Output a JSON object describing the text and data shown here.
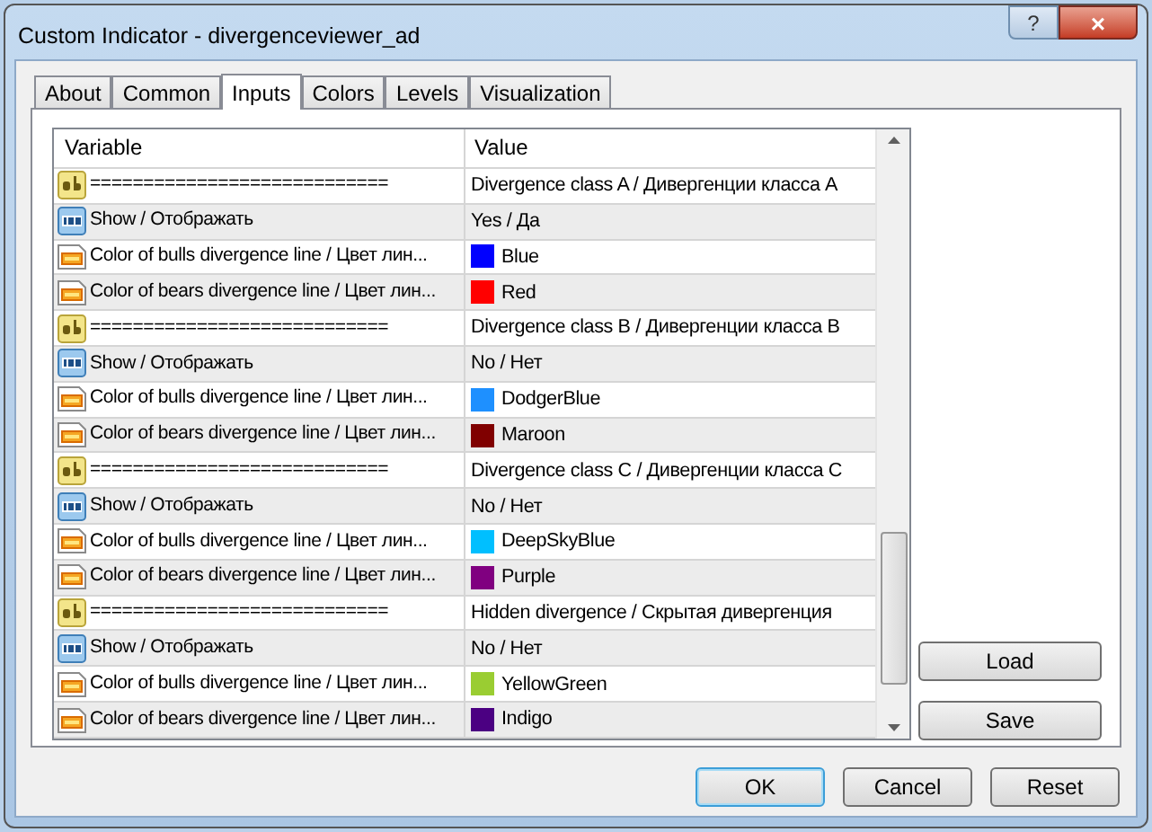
{
  "window": {
    "title": "Custom Indicator - divergenceviewer_ad"
  },
  "tabs": [
    {
      "label": "About",
      "selected": false
    },
    {
      "label": "Common",
      "selected": false
    },
    {
      "label": "Inputs",
      "selected": true
    },
    {
      "label": "Colors",
      "selected": false
    },
    {
      "label": "Levels",
      "selected": false
    },
    {
      "label": "Visualization",
      "selected": false
    }
  ],
  "table": {
    "columns": [
      "Variable",
      "Value"
    ],
    "rows": [
      {
        "kind": "string",
        "variable": "============================",
        "value": "Divergence class A / Дивергенции класса A"
      },
      {
        "kind": "number",
        "variable": "Show / Отображать",
        "value": "Yes / Да"
      },
      {
        "kind": "color",
        "variable": "Color of bulls divergence line / Цвет лин...",
        "value": "Blue",
        "color": "#0000ff"
      },
      {
        "kind": "color",
        "variable": "Color of bears divergence line / Цвет лин...",
        "value": "Red",
        "color": "#ff0000"
      },
      {
        "kind": "string",
        "variable": "============================",
        "value": "Divergence class B / Дивергенции класса B"
      },
      {
        "kind": "number",
        "variable": "Show / Отображать",
        "value": "No / Нет"
      },
      {
        "kind": "color",
        "variable": "Color of bulls divergence line / Цвет лин...",
        "value": "DodgerBlue",
        "color": "#1e90ff"
      },
      {
        "kind": "color",
        "variable": "Color of bears divergence line / Цвет лин...",
        "value": "Maroon",
        "color": "#800000"
      },
      {
        "kind": "string",
        "variable": "============================",
        "value": "Divergence class C / Дивергенции класса C"
      },
      {
        "kind": "number",
        "variable": "Show / Отображать",
        "value": "No / Нет"
      },
      {
        "kind": "color",
        "variable": "Color of bulls divergence line / Цвет лин...",
        "value": "DeepSkyBlue",
        "color": "#00bfff"
      },
      {
        "kind": "color",
        "variable": "Color of bears divergence line / Цвет лин...",
        "value": "Purple",
        "color": "#800080"
      },
      {
        "kind": "string",
        "variable": "============================",
        "value": "Hidden divergence / Скрытая дивергенция"
      },
      {
        "kind": "number",
        "variable": "Show / Отображать",
        "value": "No / Нет"
      },
      {
        "kind": "color",
        "variable": "Color of bulls divergence line / Цвет лин...",
        "value": "YellowGreen",
        "color": "#9acd32"
      },
      {
        "kind": "color",
        "variable": "Color of bears divergence line / Цвет лин...",
        "value": "Indigo",
        "color": "#4b0082"
      }
    ]
  },
  "side_buttons": [
    "Load",
    "Save"
  ],
  "buttons": [
    "OK",
    "Cancel",
    "Reset"
  ],
  "help_button": "?",
  "close_button": "×"
}
